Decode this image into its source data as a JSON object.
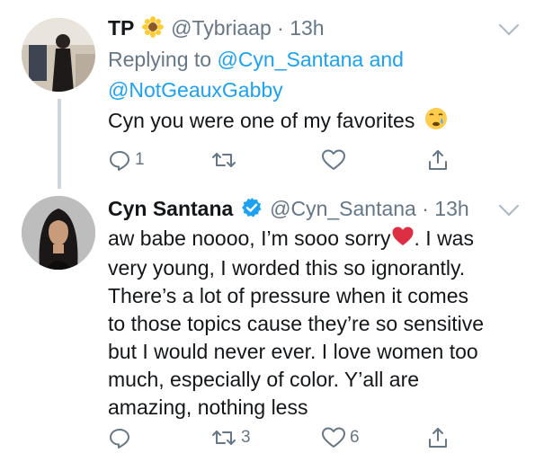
{
  "tweet1": {
    "name": "TP",
    "handle": "@Tybriaap",
    "time": "· 13h",
    "reply_prefix": "Replying to",
    "reply_mention1": "@Cyn_Santana",
    "reply_and": "and",
    "reply_mention2": "@NotGeauxGabby",
    "text": "Cyn you were one of my favorites",
    "reply_count": "1",
    "retweet_count": "",
    "like_count": ""
  },
  "tweet2": {
    "name": "Cyn Santana",
    "handle": "@Cyn_Santana",
    "time": "· 13h",
    "lines": [
      "aw babe noooo, I’m sooo sorry",
      ". I was",
      "very young, I worded this so ignorantly.",
      "There’s a lot of pressure when it comes",
      "to those topics cause they’re so sensitive",
      "but I would never ever. I love women too",
      "much, especially of color. Y’all are",
      "amazing, nothing less"
    ],
    "reply_count": "",
    "retweet_count": "3",
    "like_count": "6"
  },
  "colors": {
    "text": "#14171a",
    "secondary": "#657786",
    "link": "#1da1f2",
    "verified": "#1da1f2",
    "heart_emoji": "#e0245e"
  },
  "icons": [
    "sunflower-emoji",
    "crying-emoji",
    "verified-badge-icon",
    "red-heart-emoji",
    "reply-icon",
    "retweet-icon",
    "like-icon",
    "share-icon",
    "chevron-down-icon"
  ]
}
